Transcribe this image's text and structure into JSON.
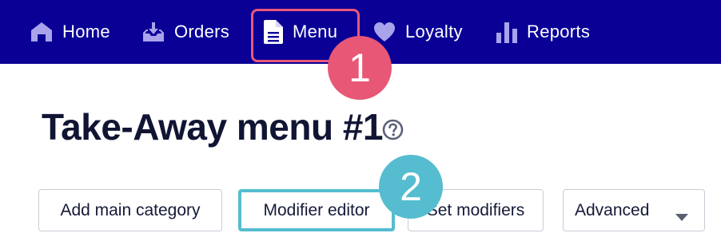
{
  "nav": {
    "items": [
      {
        "label": "Home",
        "icon": "home-icon"
      },
      {
        "label": "Orders",
        "icon": "inbox-tray-icon"
      },
      {
        "label": "Menu",
        "icon": "document-icon",
        "active": true
      },
      {
        "label": "Loyalty",
        "icon": "heart-icon"
      },
      {
        "label": "Reports",
        "icon": "bar-chart-icon"
      }
    ]
  },
  "annotations": {
    "marker_1": "1",
    "marker_2": "2"
  },
  "page": {
    "title": "Take-Away menu #1",
    "help_icon": "question-circle-icon"
  },
  "toolbar": {
    "add_main_category": "Add main category",
    "modifier_editor": "Modifier editor",
    "set_modifiers": "Set modifiers",
    "advanced": "Advanced",
    "advanced_icon": "caret-down-icon"
  },
  "colors": {
    "nav_background": "#0a0096",
    "highlight_pink": "#e85775",
    "highlight_teal": "#55bdcf",
    "title_text": "#111534"
  }
}
